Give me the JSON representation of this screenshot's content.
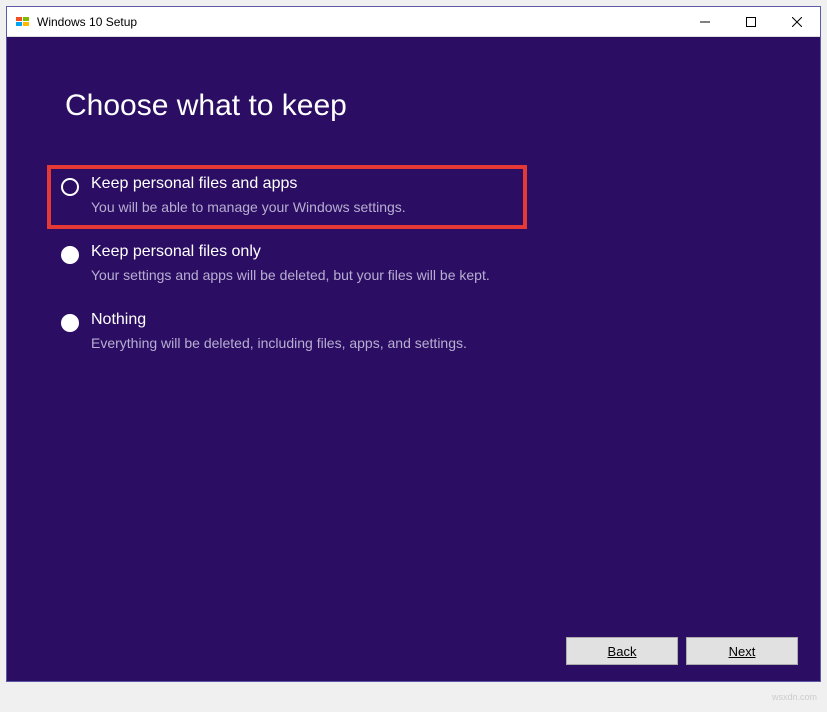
{
  "titlebar": {
    "title": "Windows 10 Setup"
  },
  "page": {
    "heading": "Choose what to keep"
  },
  "options": [
    {
      "label": "Keep personal files and apps",
      "description": "You will be able to manage your Windows settings.",
      "selected": true,
      "highlighted": true
    },
    {
      "label": "Keep personal files only",
      "description": "Your settings and apps will be deleted, but your files will be kept.",
      "selected": false,
      "highlighted": false
    },
    {
      "label": "Nothing",
      "description": "Everything will be deleted, including files, apps, and settings.",
      "selected": false,
      "highlighted": false
    }
  ],
  "footer": {
    "back": "Back",
    "next": "Next"
  },
  "watermark": "wsxdn.com"
}
